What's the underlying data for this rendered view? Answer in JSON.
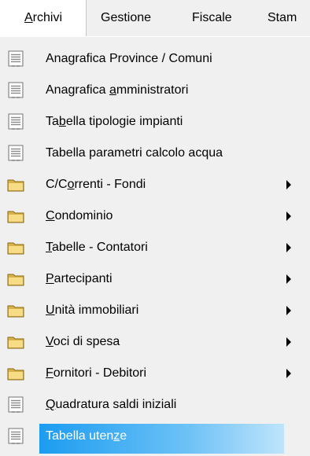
{
  "menubar": {
    "items": [
      {
        "pre": "",
        "acc": "A",
        "post": "rchivi"
      },
      {
        "pre": "",
        "acc": "",
        "post": "Gestione"
      },
      {
        "pre": "",
        "acc": "",
        "post": "Fiscale"
      },
      {
        "pre": "",
        "acc": "",
        "post": "Stam"
      }
    ]
  },
  "menu": {
    "items": [
      {
        "pre": "Anagrafica Province / Comuni",
        "acc": "",
        "post": "",
        "icon": "document-list-icon",
        "submenu": false
      },
      {
        "pre": "Anagrafica ",
        "acc": "a",
        "post": "mministratori",
        "icon": "document-list-icon",
        "submenu": false
      },
      {
        "pre": "Ta",
        "acc": "b",
        "post": "ella tipologie impianti",
        "icon": "document-list-icon",
        "submenu": false
      },
      {
        "pre": "Tabella parametri calcolo acqua",
        "acc": "",
        "post": "",
        "icon": "document-list-icon",
        "submenu": false
      },
      {
        "pre": "C/C",
        "acc": "o",
        "post": "rrenti - Fondi",
        "icon": "folder-icon",
        "submenu": true
      },
      {
        "pre": "",
        "acc": "C",
        "post": "ondominio",
        "icon": "folder-icon",
        "submenu": true
      },
      {
        "pre": "",
        "acc": "T",
        "post": "abelle - Contatori",
        "icon": "folder-icon",
        "submenu": true
      },
      {
        "pre": "",
        "acc": "P",
        "post": "artecipanti",
        "icon": "folder-icon",
        "submenu": true
      },
      {
        "pre": "",
        "acc": "U",
        "post": "nità immobiliari",
        "icon": "folder-icon",
        "submenu": true
      },
      {
        "pre": "",
        "acc": "V",
        "post": "oci di spesa",
        "icon": "folder-icon",
        "submenu": true
      },
      {
        "pre": "",
        "acc": "F",
        "post": "ornitori - Debitori",
        "icon": "folder-icon",
        "submenu": true
      },
      {
        "pre": "",
        "acc": "Q",
        "post": "uadratura saldi iniziali",
        "icon": "document-list-icon",
        "submenu": false
      },
      {
        "pre": "Tabella uten",
        "acc": "z",
        "post": "e",
        "icon": "document-list-icon",
        "submenu": false,
        "highlighted": true
      }
    ]
  }
}
